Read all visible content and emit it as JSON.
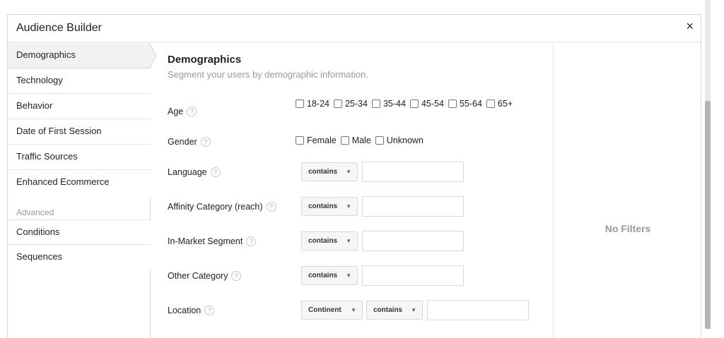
{
  "dialog": {
    "title": "Audience Builder",
    "close_label": "×"
  },
  "sidebar": {
    "items": [
      {
        "label": "Demographics",
        "active": true
      },
      {
        "label": "Technology"
      },
      {
        "label": "Behavior"
      },
      {
        "label": "Date of First Session"
      },
      {
        "label": "Traffic Sources"
      },
      {
        "label": "Enhanced Ecommerce"
      }
    ],
    "advanced_label": "Advanced",
    "advanced_items": [
      {
        "label": "Conditions"
      },
      {
        "label": "Sequences"
      }
    ]
  },
  "main": {
    "heading": "Demographics",
    "subheading": "Segment your users by demographic information.",
    "help_glyph": "?",
    "age": {
      "label": "Age",
      "options": [
        "18-24",
        "25-34",
        "35-44",
        "45-54",
        "55-64",
        "65+"
      ]
    },
    "gender": {
      "label": "Gender",
      "options": [
        "Female",
        "Male",
        "Unknown"
      ]
    },
    "language": {
      "label": "Language",
      "operator": "contains",
      "value": ""
    },
    "affinity": {
      "label": "Affinity Category (reach)",
      "operator": "contains",
      "value": ""
    },
    "in_market": {
      "label": "In-Market Segment",
      "operator": "contains",
      "value": ""
    },
    "other": {
      "label": "Other Category",
      "operator": "contains",
      "value": ""
    },
    "location": {
      "label": "Location",
      "level": "Continent",
      "operator": "contains",
      "value": ""
    },
    "caret": "▼"
  },
  "filters_panel": {
    "empty_text": "No Filters"
  },
  "colors": {
    "accent_text": "#222222",
    "muted_text": "#999999",
    "active_bg": "#f2f2f2",
    "border": "#d6d6d6"
  }
}
